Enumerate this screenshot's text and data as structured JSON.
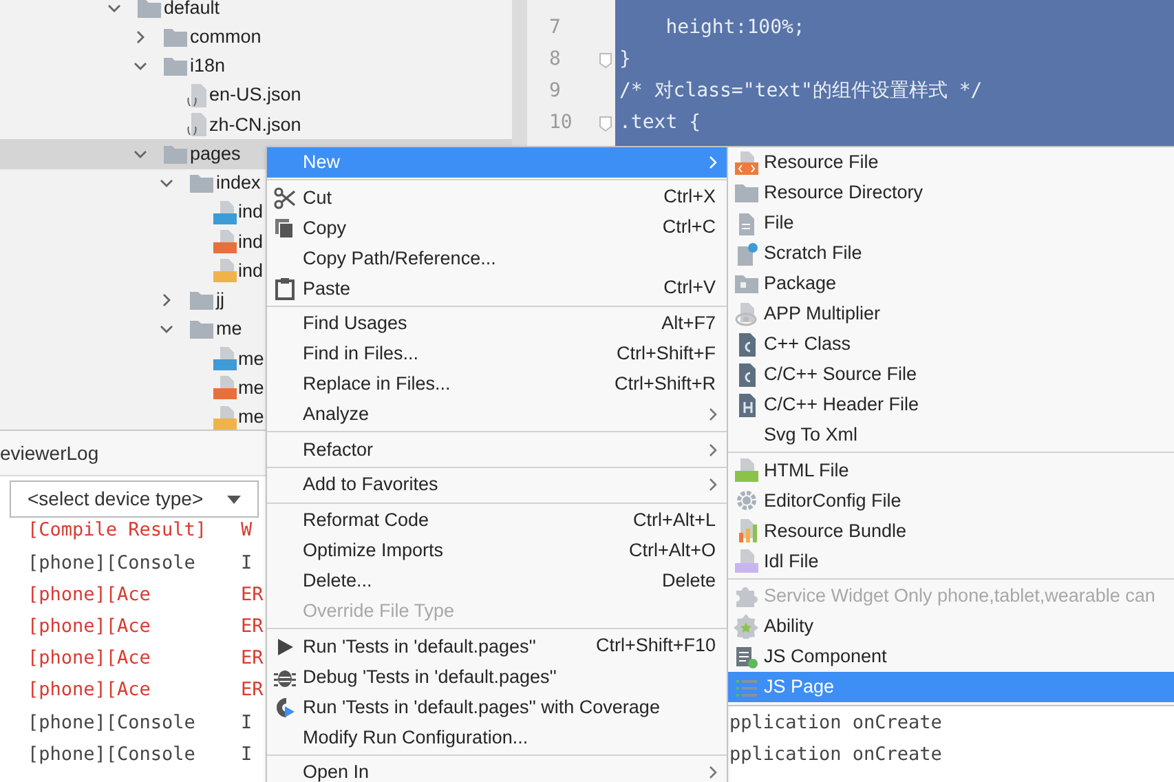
{
  "project_tree": [
    {
      "label": "default",
      "kind": "folder",
      "expanded": true,
      "children": [
        {
          "label": "common",
          "kind": "folder",
          "expanded": false
        },
        {
          "label": "i18n",
          "kind": "folder",
          "expanded": true,
          "children": [
            {
              "label": "en-US.json",
              "kind": "json"
            },
            {
              "label": "zh-CN.json",
              "kind": "json"
            }
          ]
        },
        {
          "label": "pages",
          "kind": "folder",
          "expanded": true,
          "selected": true,
          "children": [
            {
              "label": "index",
              "kind": "folder",
              "expanded": true,
              "children": [
                {
                  "label": "ind",
                  "kind": "css"
                },
                {
                  "label": "ind",
                  "kind": "html"
                },
                {
                  "label": "ind",
                  "kind": "js"
                }
              ]
            },
            {
              "label": "jj",
              "kind": "folder",
              "expanded": false
            },
            {
              "label": "me",
              "kind": "folder",
              "expanded": true,
              "children": [
                {
                  "label": "me",
                  "kind": "css"
                },
                {
                  "label": "me",
                  "kind": "html"
                },
                {
                  "label": "me",
                  "kind": "js"
                }
              ]
            }
          ]
        }
      ]
    }
  ],
  "editor": {
    "lines": [
      {
        "number": "7",
        "text": "    height:100%;",
        "fold": false
      },
      {
        "number": "8",
        "text": "}",
        "fold": true
      },
      {
        "number": "9",
        "text": "/* 对class=\"text\"的组件设置样式 */",
        "fold": false
      },
      {
        "number": "10",
        "text": ".text {",
        "fold": true
      }
    ]
  },
  "log_panel": {
    "title": "eviewerLog",
    "device_select": {
      "value": "<select device type>"
    },
    "rows": [
      {
        "source": "[Compile Result]",
        "level": "W",
        "kind": "error"
      },
      {
        "source": "[phone][Console",
        "level": "I",
        "kind": "info"
      },
      {
        "source": "[phone][Ace",
        "level": "ER",
        "kind": "error"
      },
      {
        "source": "[phone][Ace",
        "level": "ER",
        "kind": "error"
      },
      {
        "source": "[phone][Ace",
        "level": "ER",
        "kind": "error"
      },
      {
        "source": "[phone][Ace",
        "level": "ER",
        "kind": "error"
      },
      {
        "source": "[phone][Console",
        "level": "I",
        "message": "pplication onCreate",
        "kind": "info"
      },
      {
        "source": "[phone][Console",
        "level": "I",
        "message": "pplication onCreate",
        "kind": "info"
      }
    ]
  },
  "context_menu": {
    "groups": [
      [
        {
          "label": "New",
          "submenu": true,
          "selected": true
        }
      ],
      [
        {
          "label": "Cut",
          "shortcut": "Ctrl+X",
          "selected": false
        },
        {
          "label": "Copy",
          "shortcut": "Ctrl+C",
          "selected": false
        },
        {
          "label": "Copy Path/Reference...",
          "selected": false
        },
        {
          "label": "Paste",
          "shortcut": "Ctrl+V",
          "selected": false
        }
      ],
      [
        {
          "label": "Find Usages",
          "shortcut": "Alt+F7",
          "selected": false
        },
        {
          "label": "Find in Files...",
          "shortcut": "Ctrl+Shift+F",
          "selected": false
        },
        {
          "label": "Replace in Files...",
          "shortcut": "Ctrl+Shift+R",
          "selected": false
        },
        {
          "label": "Analyze",
          "submenu": true,
          "selected": false
        }
      ],
      [
        {
          "label": "Refactor",
          "submenu": true,
          "selected": false
        }
      ],
      [
        {
          "label": "Add to Favorites",
          "submenu": true,
          "selected": false
        }
      ],
      [
        {
          "label": "Reformat Code",
          "shortcut": "Ctrl+Alt+L",
          "selected": false
        },
        {
          "label": "Optimize Imports",
          "shortcut": "Ctrl+Alt+O",
          "selected": false
        },
        {
          "label": "Delete...",
          "shortcut": "Delete",
          "selected": false
        },
        {
          "label": "Override File Type",
          "disabled": true,
          "selected": false
        }
      ],
      [
        {
          "label": "Run 'Tests in 'default.pages''",
          "shortcut": "Ctrl+Shift+F10",
          "selected": false
        },
        {
          "label": "Debug 'Tests in 'default.pages''",
          "selected": false
        },
        {
          "label": "Run 'Tests in 'default.pages'' with Coverage",
          "selected": false
        },
        {
          "label": "Modify Run Configuration...",
          "selected": false
        }
      ],
      [
        {
          "label": "Open In",
          "submenu": true,
          "selected": false
        }
      ]
    ]
  },
  "new_submenu": {
    "groups": [
      [
        {
          "label": "Resource File",
          "selected": false
        },
        {
          "label": "Resource Directory",
          "selected": false
        },
        {
          "label": "File",
          "selected": false
        },
        {
          "label": "Scratch File",
          "selected": false
        },
        {
          "label": "Package",
          "selected": false
        },
        {
          "label": "APP Multiplier",
          "selected": false
        },
        {
          "label": "C++ Class",
          "selected": false
        },
        {
          "label": "C/C++ Source File",
          "selected": false
        },
        {
          "label": "C/C++ Header File",
          "selected": false
        },
        {
          "label": "Svg To Xml",
          "selected": false
        }
      ],
      [
        {
          "label": "HTML File",
          "selected": false
        },
        {
          "label": "EditorConfig File",
          "selected": false
        },
        {
          "label": "Resource Bundle",
          "selected": false
        },
        {
          "label": "Idl File",
          "selected": false
        }
      ],
      [
        {
          "label": "Service Widget Only phone,tablet,wearable can",
          "disabled": true,
          "selected": false
        },
        {
          "label": "Ability",
          "selected": false
        },
        {
          "label": "JS Component",
          "selected": false
        },
        {
          "label": "JS Page",
          "selected": true
        }
      ]
    ]
  }
}
